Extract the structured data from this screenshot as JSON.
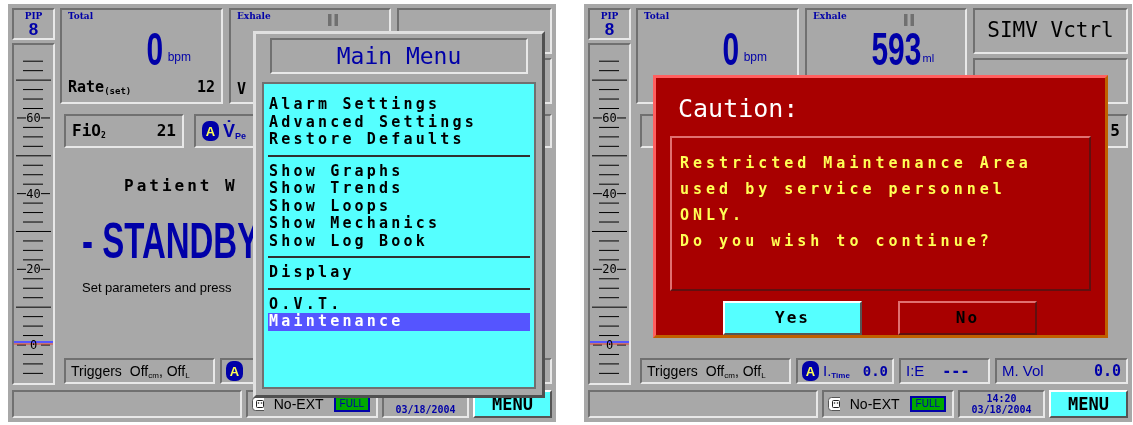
{
  "screens": [
    {
      "pip": {
        "label": "PIP",
        "value": "8"
      },
      "scale_labels": [
        "60",
        "40",
        "20",
        "0"
      ],
      "total": {
        "label": "Total",
        "value": "0",
        "unit": "bpm",
        "set_label": "Rate$_{(set)}$",
        "set_value": "12"
      },
      "exhale": {
        "label": "Exhale",
        "set_label": "V"
      },
      "fio2": {
        "label": "FiO$_{2}$",
        "value": "21"
      },
      "peak": {
        "badge": "A",
        "label": "V̇$_{Pe}$"
      },
      "center_lines": [
        {
          "kind": "title",
          "text": "Patient W"
        },
        {
          "kind": "standby",
          "text": "- STANDBY"
        },
        {
          "kind": "hint",
          "text": "Set parameters and press"
        }
      ],
      "triggers": {
        "label": "Triggers",
        "value": "Off$_{cm}$, Off$_{L}$"
      },
      "itime": {
        "badge": "A"
      },
      "status": {
        "power": "No-EXT",
        "battery": "FULL",
        "date": "03/18/2004",
        "menu": "MENU"
      },
      "overlay": {
        "kind": "menu",
        "title": "Main Menu",
        "groups": [
          [
            {
              "label": "Alarm Settings",
              "selected": false
            },
            {
              "label": "Advanced Settings",
              "selected": false
            },
            {
              "label": "Restore Defaults",
              "selected": false
            }
          ],
          [
            {
              "label": "Show Graphs",
              "selected": false
            },
            {
              "label": "Show Trends",
              "selected": false
            },
            {
              "label": "Show Loops",
              "selected": false
            },
            {
              "label": "Show Mechanics",
              "selected": false
            },
            {
              "label": "Show Log Book",
              "selected": false
            }
          ],
          [
            {
              "label": "Display",
              "selected": false
            }
          ],
          [
            {
              "label": "O.V.T.",
              "selected": false
            },
            {
              "label": "Maintenance",
              "selected": true
            }
          ]
        ]
      }
    },
    {
      "pip": {
        "label": "PIP",
        "value": "8"
      },
      "scale_labels": [
        "60",
        "40",
        "20",
        "0"
      ],
      "total": {
        "label": "Total",
        "value": "0",
        "unit": "bpm"
      },
      "exhale": {
        "label": "Exhale",
        "value": "593",
        "unit": "ml"
      },
      "mode": {
        "text": "SIMV Vctrl"
      },
      "row2_right": {
        "value": "5"
      },
      "triggers": {
        "label": "Triggers",
        "value": "Off$_{cm}$, Off$_{L}$"
      },
      "itime": {
        "badge": "A",
        "label": "I.$_{Time}$",
        "value": "0.0"
      },
      "ie": {
        "label": "I:E",
        "value": "---"
      },
      "mvol": {
        "label": "M. Vol",
        "value": "0.0"
      },
      "status": {
        "power": "No-EXT",
        "battery": "FULL",
        "time": "14:20",
        "date": "03/18/2004",
        "menu": "MENU"
      },
      "overlay": {
        "kind": "dialog",
        "title": "Caution:",
        "message_lines": [
          "Restricted Maintenance Area",
          "used by service personnel",
          "ONLY.",
          "Do you wish to continue?"
        ],
        "buttons": [
          {
            "label": "Yes",
            "selected": true
          },
          {
            "label": "No",
            "selected": false
          }
        ]
      }
    }
  ]
}
